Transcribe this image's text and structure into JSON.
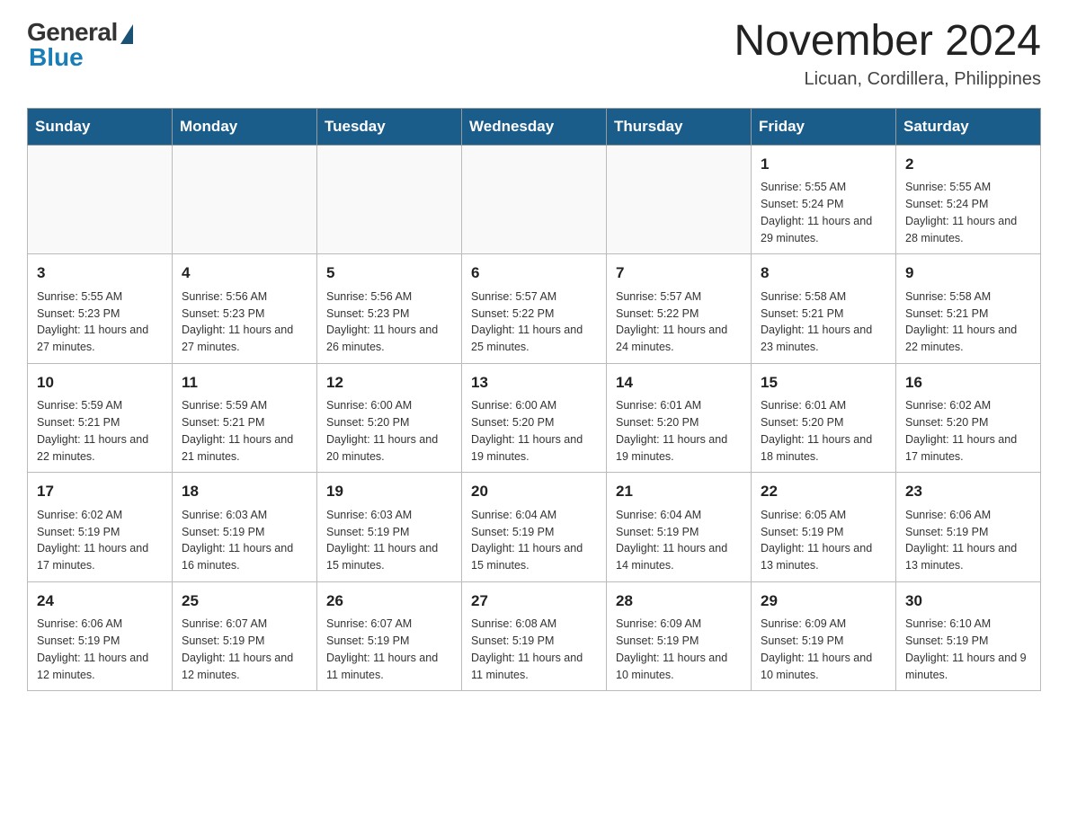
{
  "header": {
    "logo": {
      "general": "General",
      "blue": "Blue"
    },
    "title": "November 2024",
    "location": "Licuan, Cordillera, Philippines"
  },
  "calendar": {
    "days_of_week": [
      "Sunday",
      "Monday",
      "Tuesday",
      "Wednesday",
      "Thursday",
      "Friday",
      "Saturday"
    ],
    "weeks": [
      [
        {
          "day": "",
          "info": ""
        },
        {
          "day": "",
          "info": ""
        },
        {
          "day": "",
          "info": ""
        },
        {
          "day": "",
          "info": ""
        },
        {
          "day": "",
          "info": ""
        },
        {
          "day": "1",
          "info": "Sunrise: 5:55 AM\nSunset: 5:24 PM\nDaylight: 11 hours and 29 minutes."
        },
        {
          "day": "2",
          "info": "Sunrise: 5:55 AM\nSunset: 5:24 PM\nDaylight: 11 hours and 28 minutes."
        }
      ],
      [
        {
          "day": "3",
          "info": "Sunrise: 5:55 AM\nSunset: 5:23 PM\nDaylight: 11 hours and 27 minutes."
        },
        {
          "day": "4",
          "info": "Sunrise: 5:56 AM\nSunset: 5:23 PM\nDaylight: 11 hours and 27 minutes."
        },
        {
          "day": "5",
          "info": "Sunrise: 5:56 AM\nSunset: 5:23 PM\nDaylight: 11 hours and 26 minutes."
        },
        {
          "day": "6",
          "info": "Sunrise: 5:57 AM\nSunset: 5:22 PM\nDaylight: 11 hours and 25 minutes."
        },
        {
          "day": "7",
          "info": "Sunrise: 5:57 AM\nSunset: 5:22 PM\nDaylight: 11 hours and 24 minutes."
        },
        {
          "day": "8",
          "info": "Sunrise: 5:58 AM\nSunset: 5:21 PM\nDaylight: 11 hours and 23 minutes."
        },
        {
          "day": "9",
          "info": "Sunrise: 5:58 AM\nSunset: 5:21 PM\nDaylight: 11 hours and 22 minutes."
        }
      ],
      [
        {
          "day": "10",
          "info": "Sunrise: 5:59 AM\nSunset: 5:21 PM\nDaylight: 11 hours and 22 minutes."
        },
        {
          "day": "11",
          "info": "Sunrise: 5:59 AM\nSunset: 5:21 PM\nDaylight: 11 hours and 21 minutes."
        },
        {
          "day": "12",
          "info": "Sunrise: 6:00 AM\nSunset: 5:20 PM\nDaylight: 11 hours and 20 minutes."
        },
        {
          "day": "13",
          "info": "Sunrise: 6:00 AM\nSunset: 5:20 PM\nDaylight: 11 hours and 19 minutes."
        },
        {
          "day": "14",
          "info": "Sunrise: 6:01 AM\nSunset: 5:20 PM\nDaylight: 11 hours and 19 minutes."
        },
        {
          "day": "15",
          "info": "Sunrise: 6:01 AM\nSunset: 5:20 PM\nDaylight: 11 hours and 18 minutes."
        },
        {
          "day": "16",
          "info": "Sunrise: 6:02 AM\nSunset: 5:20 PM\nDaylight: 11 hours and 17 minutes."
        }
      ],
      [
        {
          "day": "17",
          "info": "Sunrise: 6:02 AM\nSunset: 5:19 PM\nDaylight: 11 hours and 17 minutes."
        },
        {
          "day": "18",
          "info": "Sunrise: 6:03 AM\nSunset: 5:19 PM\nDaylight: 11 hours and 16 minutes."
        },
        {
          "day": "19",
          "info": "Sunrise: 6:03 AM\nSunset: 5:19 PM\nDaylight: 11 hours and 15 minutes."
        },
        {
          "day": "20",
          "info": "Sunrise: 6:04 AM\nSunset: 5:19 PM\nDaylight: 11 hours and 15 minutes."
        },
        {
          "day": "21",
          "info": "Sunrise: 6:04 AM\nSunset: 5:19 PM\nDaylight: 11 hours and 14 minutes."
        },
        {
          "day": "22",
          "info": "Sunrise: 6:05 AM\nSunset: 5:19 PM\nDaylight: 11 hours and 13 minutes."
        },
        {
          "day": "23",
          "info": "Sunrise: 6:06 AM\nSunset: 5:19 PM\nDaylight: 11 hours and 13 minutes."
        }
      ],
      [
        {
          "day": "24",
          "info": "Sunrise: 6:06 AM\nSunset: 5:19 PM\nDaylight: 11 hours and 12 minutes."
        },
        {
          "day": "25",
          "info": "Sunrise: 6:07 AM\nSunset: 5:19 PM\nDaylight: 11 hours and 12 minutes."
        },
        {
          "day": "26",
          "info": "Sunrise: 6:07 AM\nSunset: 5:19 PM\nDaylight: 11 hours and 11 minutes."
        },
        {
          "day": "27",
          "info": "Sunrise: 6:08 AM\nSunset: 5:19 PM\nDaylight: 11 hours and 11 minutes."
        },
        {
          "day": "28",
          "info": "Sunrise: 6:09 AM\nSunset: 5:19 PM\nDaylight: 11 hours and 10 minutes."
        },
        {
          "day": "29",
          "info": "Sunrise: 6:09 AM\nSunset: 5:19 PM\nDaylight: 11 hours and 10 minutes."
        },
        {
          "day": "30",
          "info": "Sunrise: 6:10 AM\nSunset: 5:19 PM\nDaylight: 11 hours and 9 minutes."
        }
      ]
    ]
  }
}
